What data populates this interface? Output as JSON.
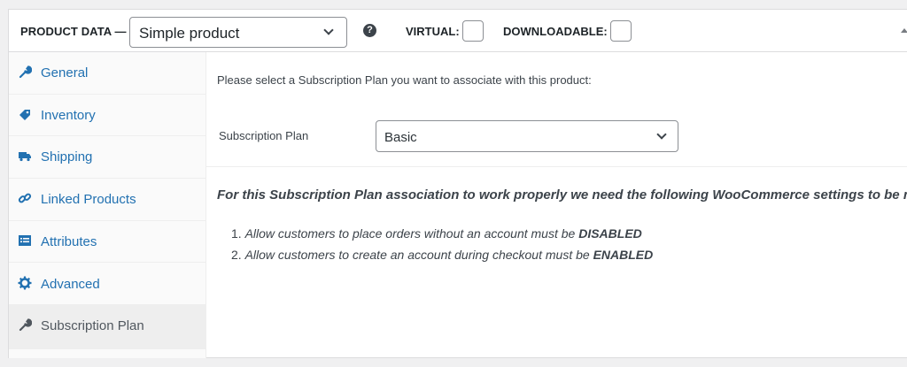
{
  "header": {
    "product_data_label": "PRODUCT DATA —",
    "product_type": "Simple product",
    "help_glyph": "?",
    "virtual_label": "VIRTUAL:",
    "downloadable_label": "DOWNLOADABLE:"
  },
  "tabs": [
    {
      "label": "General",
      "icon": "wrench-icon"
    },
    {
      "label": "Inventory",
      "icon": "tag-icon"
    },
    {
      "label": "Shipping",
      "icon": "truck-icon"
    },
    {
      "label": "Linked Products",
      "icon": "link-icon"
    },
    {
      "label": "Attributes",
      "icon": "list-icon"
    },
    {
      "label": "Advanced",
      "icon": "gear-icon"
    },
    {
      "label": "Subscription Plan",
      "icon": "wrench-icon",
      "active": true
    }
  ],
  "content": {
    "intro": "Please select a Subscription Plan you want to associate with this product:",
    "plan_label": "Subscription Plan",
    "plan_value": "Basic",
    "note": "For this Subscription Plan association to work properly we need the following WooCommerce settings to be met:",
    "requirements": [
      {
        "num": "1.",
        "text": "Allow customers to place orders without an account must be ",
        "emphasis": "DISABLED"
      },
      {
        "num": "2.",
        "text": "Allow customers to create an account during checkout must be ",
        "emphasis": "ENABLED"
      }
    ]
  },
  "colors": {
    "link": "#2271b1",
    "active_tab_bg": "#eeeeee",
    "text": "#3c434a"
  }
}
